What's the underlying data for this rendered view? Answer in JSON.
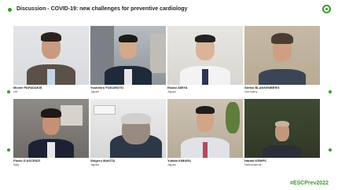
{
  "header": {
    "title": "Discussion - COVID-19: new challenges for preventive cardiology"
  },
  "participants": [
    {
      "name": "Michel PAPADAKIS",
      "country": "UK"
    },
    {
      "name": "Yoshihiro FUKUMOTO",
      "country": "Japan"
    },
    {
      "name": "Ekoko AMIYA",
      "country": "Japan"
    },
    {
      "name": "Stefan BLANKENBERG",
      "country": "Germany"
    },
    {
      "name": "Flavio D'ASCENZI",
      "country": "Italy"
    },
    {
      "name": "Shigeru MAKITA",
      "country": "Japan"
    },
    {
      "name": "Yutaka KIMURA",
      "country": "Japan"
    },
    {
      "name": "Harald KEMPS",
      "country": "Netherlands"
    }
  ],
  "footer": {
    "hashtag": "#ESCPrev2022"
  },
  "colors": {
    "accent": "#3a9a2c"
  }
}
